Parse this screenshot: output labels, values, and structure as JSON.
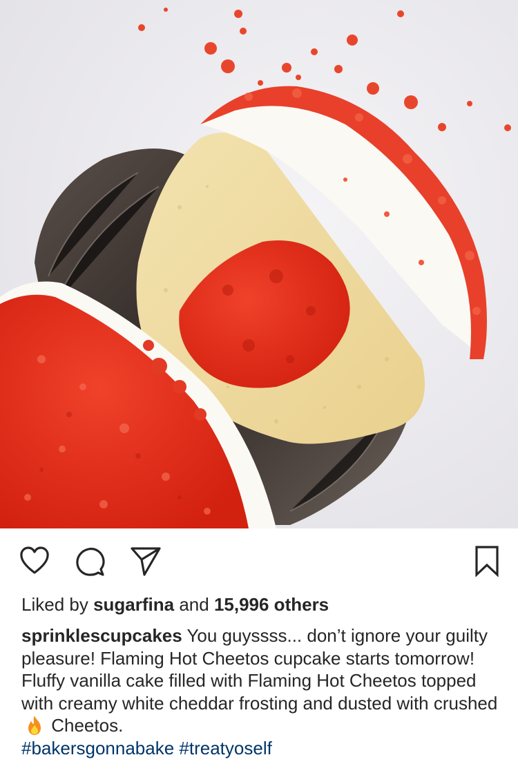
{
  "post": {
    "photo_alt": "Flaming Hot Cheetos cupcake cut in half",
    "actions": {
      "like_icon": "heart-icon",
      "comment_icon": "comment-icon",
      "share_icon": "paper-plane-icon",
      "save_icon": "bookmark-icon"
    },
    "likes": {
      "prefix": "Liked by ",
      "user": "sugarfina",
      "middle": " and ",
      "count": "15,996 others"
    },
    "caption": {
      "username": "sprinklescupcakes",
      "text_before_emoji": " You guyssss... don’t ignore your guilty pleasure! Flaming Hot Cheetos cupcake starts tomorrow! Fluffy vanilla cake filled with Flaming Hot Cheetos topped with creamy white cheddar frosting and dusted with crushed",
      "emoji": "fire-emoji",
      "text_after_emoji": " Cheetos.",
      "hashtags": [
        "#bakersgonnabake",
        "#treatyoself"
      ]
    },
    "colors": {
      "text": "#262626",
      "hashtag": "#003569",
      "cheeto_red": "#e8321e",
      "cake": "#f1dfa8"
    }
  }
}
